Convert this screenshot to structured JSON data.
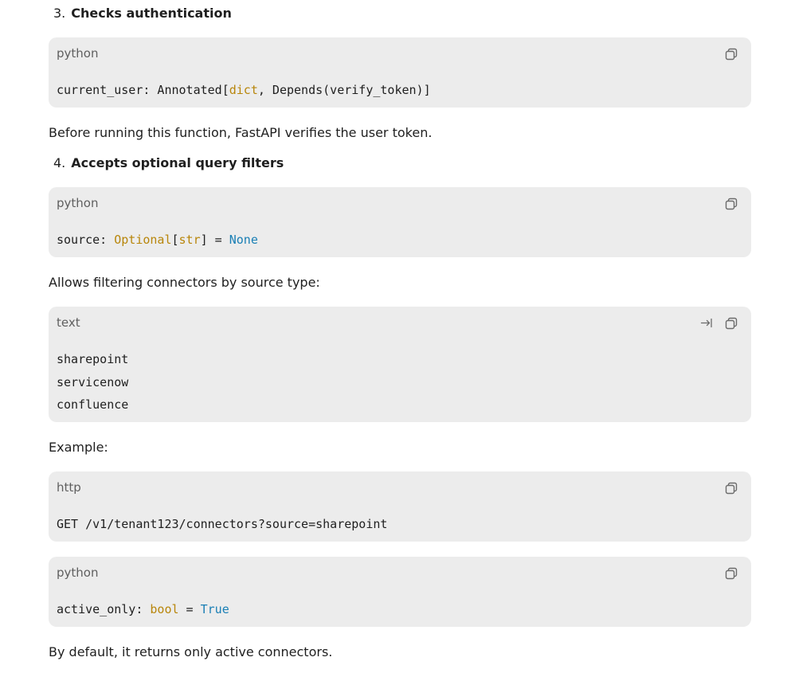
{
  "items": [
    {
      "number": "3.",
      "title": "Checks authentication"
    },
    {
      "number": "4.",
      "title": "Accepts optional query filters"
    }
  ],
  "paragraphs": {
    "verify": "Before running this function, FastAPI verifies the user token.",
    "filter": "Allows filtering connectors by source type:",
    "example": "Example:",
    "default": "By default, it returns only active connectors."
  },
  "code_blocks": {
    "auth": {
      "language": "python",
      "parts": {
        "a": "current_user: Annotated[",
        "b": "dict",
        "c": ", Depends(verify_token)]"
      }
    },
    "source": {
      "language": "python",
      "parts": {
        "a": "source: ",
        "b": "Optional",
        "c": "[",
        "d": "str",
        "e": "] = ",
        "f": "None"
      }
    },
    "types": {
      "language": "text",
      "lines": [
        "sharepoint",
        "servicenow",
        "confluence"
      ]
    },
    "request": {
      "language": "http",
      "line": "GET /v1/tenant123/connectors?source=sharepoint"
    },
    "active": {
      "language": "python",
      "parts": {
        "a": "active_only: ",
        "b": "bool",
        "c": " = ",
        "d": "True"
      }
    }
  },
  "icons": {
    "copy": "copy-icon",
    "wrap": "wrap-lines-icon"
  },
  "colors": {
    "code_background": "#ececec",
    "type_token": "#b8860b",
    "keyword_token": "#1a7fb5",
    "muted_text": "#5f5f5f"
  }
}
